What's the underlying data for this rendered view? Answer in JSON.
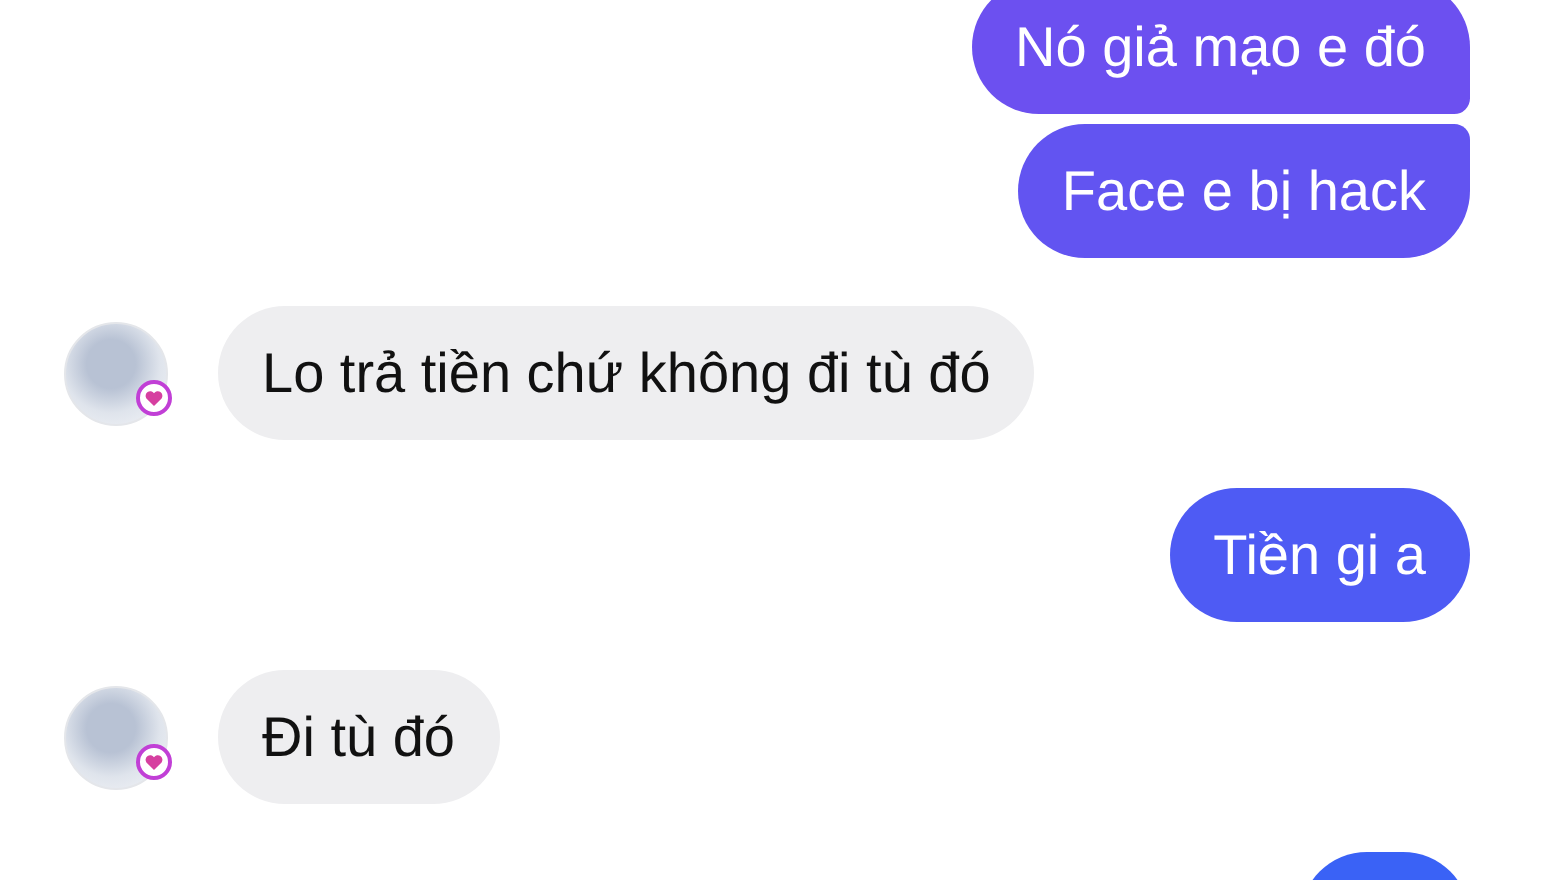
{
  "messages": [
    {
      "kind": "outgoing",
      "text": "Nó giả mạo e đó"
    },
    {
      "kind": "outgoing",
      "text": "Face e bị hack"
    },
    {
      "kind": "incoming",
      "text": "Lo trả tiền chứ không đi tù đó"
    },
    {
      "kind": "outgoing",
      "text": "Tiền gi a"
    },
    {
      "kind": "incoming",
      "text": "Đi tù đó"
    },
    {
      "kind": "outgoing"
    }
  ]
}
